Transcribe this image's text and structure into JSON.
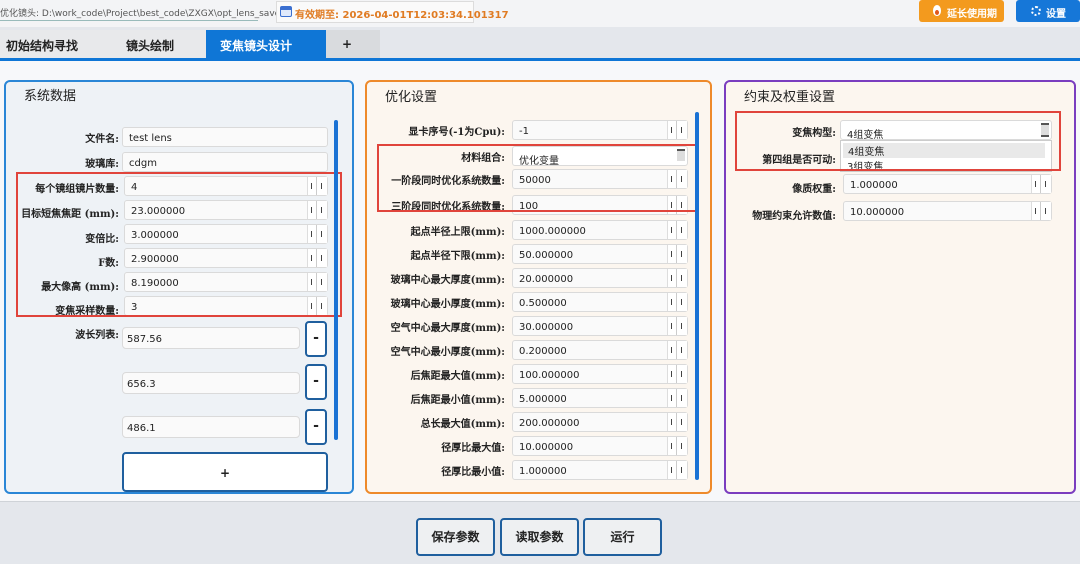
{
  "topbar": {
    "path_label": "优化镜头: D:\\work_code\\Project\\best_code\\ZXGX\\opt_lens_save",
    "valid_label": "有效期至: 2026-04-01T12:03:34.101317",
    "extend_button": "延长使用期",
    "settings_button": "设置",
    "colors": {
      "extend": "#f39a1e",
      "settings": "#1677d8",
      "valid_text": "#e07b22"
    }
  },
  "tabs": [
    {
      "label": "初始结构寻找",
      "active": false
    },
    {
      "label": "镜头绘制",
      "active": false
    },
    {
      "label": "变焦镜头设计",
      "active": true
    },
    {
      "label": "+",
      "active": false
    }
  ],
  "system_panel": {
    "title": "系统数据",
    "fields": [
      {
        "label": "文件名:",
        "value": "test lens"
      },
      {
        "label": "玻璃库:",
        "value": "cdgm"
      },
      {
        "label": "每个镜组镜片数量:",
        "value": "4"
      },
      {
        "label": "目标短焦焦距 (mm):",
        "value": "23.000000"
      },
      {
        "label": "变倍比:",
        "value": "3.000000"
      },
      {
        "label": "F数:",
        "value": "2.900000"
      },
      {
        "label": "最大像高 (mm):",
        "value": "8.190000"
      },
      {
        "label": "变焦采样数量:",
        "value": "3"
      }
    ],
    "wavelength_label": "波长列表:",
    "wavelengths": [
      "587.56",
      "656.3",
      "486.1"
    ],
    "remove_label": "-",
    "add_label": "+"
  },
  "optimization_panel": {
    "title": "优化设置",
    "fields": [
      {
        "label": "显卡序号(-1为Cpu):",
        "value": "-1"
      },
      {
        "label": "材料组合:",
        "value": "优化变量"
      },
      {
        "label": "一阶段同时优化系统数量:",
        "value": "50000"
      },
      {
        "label": "三阶段同时优化系统数量:",
        "value": "100"
      },
      {
        "label": "起点半径上限(mm):",
        "value": "1000.000000"
      },
      {
        "label": "起点半径下限(mm):",
        "value": "50.000000"
      },
      {
        "label": "玻璃中心最大厚度(mm):",
        "value": "20.000000"
      },
      {
        "label": "玻璃中心最小厚度(mm):",
        "value": "0.500000"
      },
      {
        "label": "空气中心最大厚度(mm):",
        "value": "30.000000"
      },
      {
        "label": "空气中心最小厚度(mm):",
        "value": "0.200000"
      },
      {
        "label": "后焦距最大值(mm):",
        "value": "100.000000"
      },
      {
        "label": "后焦距最小值(mm):",
        "value": "5.000000"
      },
      {
        "label": "总长最大值(mm):",
        "value": "200.000000"
      },
      {
        "label": "径厚比最大值:",
        "value": "10.000000"
      },
      {
        "label": "径厚比最小值:",
        "value": "1.000000"
      }
    ]
  },
  "constraint_panel": {
    "title": "约束及权重设置",
    "zoom_type_label": "变焦构型:",
    "zoom_type_value": "4组变焦",
    "dropdown_options": [
      "4组变焦",
      "3组变焦"
    ],
    "group4_label": "第四组是否可动:",
    "fields": [
      {
        "label": "像质权重:",
        "value": "1.000000"
      },
      {
        "label": "物理约束允许数值:",
        "value": "10.000000"
      }
    ]
  },
  "bottom": {
    "save_label": "保存参数",
    "load_label": "读取参数",
    "run_label": "运行"
  }
}
